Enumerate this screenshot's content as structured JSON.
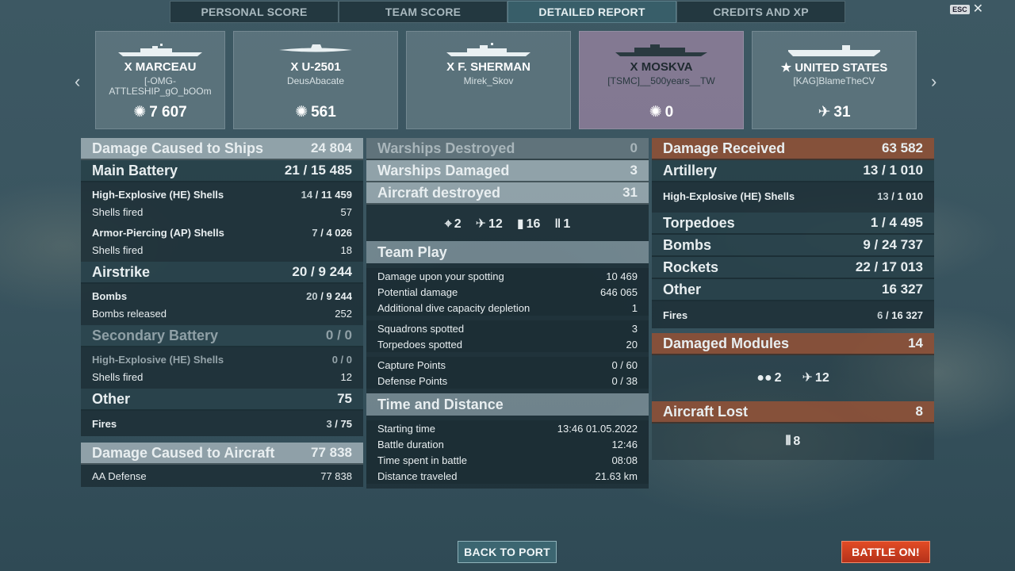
{
  "tabs": [
    "PERSONAL SCORE",
    "TEAM SCORE",
    "DETAILED REPORT",
    "CREDITS AND XP"
  ],
  "active_tab": "DETAILED REPORT",
  "esc_label": "ESC",
  "ships": [
    {
      "name": "X MARCEAU",
      "player": "[-OMG-\nATTLESHIP_gO_bOOm",
      "score": "7 607",
      "score_icon": "damage-burst-icon"
    },
    {
      "name": "X U-2501",
      "player": "DeusAbacate",
      "score": "561",
      "score_icon": "damage-burst-icon"
    },
    {
      "name": "X F. SHERMAN",
      "player": "Mirek_Skov",
      "score": "",
      "score_icon": ""
    },
    {
      "name": "X MOSKVA",
      "player": "[TSMC]__500years__TW",
      "score": "0",
      "score_icon": "damage-burst-icon"
    },
    {
      "name": "★ UNITED STATES",
      "player": "[KAG]BlameTheCV",
      "score": "31",
      "score_icon": "plane-destroyed-icon"
    }
  ],
  "left": {
    "damage_ships": {
      "label": "Damage Caused to Ships",
      "value": "24 804"
    },
    "main_battery": {
      "label": "Main Battery",
      "hits": "21",
      "value": "15 485"
    },
    "he_shells": {
      "label": "High-Explosive (HE) Shells",
      "hits": "14",
      "value": "11 459"
    },
    "he_fired": {
      "label": "Shells fired",
      "value": "57"
    },
    "ap_shells": {
      "label": "Armor-Piercing (AP) Shells",
      "hits": "7",
      "value": "4 026"
    },
    "ap_fired": {
      "label": "Shells fired",
      "value": "18"
    },
    "airstrike": {
      "label": "Airstrike",
      "hits": "20",
      "value": "9 244"
    },
    "bombs": {
      "label": "Bombs",
      "hits": "20",
      "value": "9 244"
    },
    "bombs_released": {
      "label": "Bombs released",
      "value": "252"
    },
    "secondary": {
      "label": "Secondary Battery",
      "value": "0 / 0"
    },
    "sec_he": {
      "label": "High-Explosive (HE) Shells",
      "value": "0 / 0"
    },
    "sec_fired": {
      "label": "Shells fired",
      "value": "12"
    },
    "other": {
      "label": "Other",
      "value": "75"
    },
    "fires": {
      "label": "Fires",
      "hits": "3",
      "value": "75"
    },
    "damage_aircraft": {
      "label": "Damage Caused to Aircraft",
      "value": "77 838"
    },
    "aa_defense": {
      "label": "AA Defense",
      "value": "77 838"
    }
  },
  "middle": {
    "warships_destroyed": {
      "label": "Warships Destroyed",
      "value": "0"
    },
    "warships_damaged": {
      "label": "Warships Damaged",
      "value": "3"
    },
    "aircraft_destroyed": {
      "label": "Aircraft destroyed",
      "value": "31"
    },
    "kill_icons": [
      {
        "icon": "crosshair-icon",
        "value": "2"
      },
      {
        "icon": "plane-shot-icon",
        "value": "12"
      },
      {
        "icon": "bomb-icon",
        "value": "16"
      },
      {
        "icon": "torpedo-salvo-icon",
        "value": "1"
      }
    ],
    "team_play": {
      "title": "Team Play",
      "rows": [
        {
          "label": "Damage upon your spotting",
          "value": "10 469"
        },
        {
          "label": "Potential damage",
          "value": "646 065"
        },
        {
          "label": "Additional dive capacity depletion",
          "value": "1"
        },
        {
          "label": "Squadrons spotted",
          "value": "3"
        },
        {
          "label": "Torpedoes spotted",
          "value": "20"
        },
        {
          "label": "Capture Points",
          "value": "0 / 60"
        },
        {
          "label": "Defense Points",
          "value": "0 / 38"
        }
      ]
    },
    "time_distance": {
      "title": "Time and Distance",
      "rows": [
        {
          "label": "Starting time",
          "value": "13:46  01.05.2022"
        },
        {
          "label": "Battle duration",
          "value": "12:46"
        },
        {
          "label": "Time spent in battle",
          "value": "08:08"
        },
        {
          "label": "Distance traveled",
          "value": "21.63 km"
        }
      ]
    }
  },
  "right": {
    "damage_received": {
      "label": "Damage Received",
      "value": "63 582"
    },
    "artillery": {
      "label": "Artillery",
      "hits": "13",
      "value": "1 010"
    },
    "he_shells": {
      "label": "High-Explosive (HE) Shells",
      "hits": "13",
      "value": "1 010"
    },
    "torpedoes": {
      "label": "Torpedoes",
      "hits": "1",
      "value": "4 495"
    },
    "bombs": {
      "label": "Bombs",
      "hits": "9",
      "value": "24 737"
    },
    "rockets": {
      "label": "Rockets",
      "hits": "22",
      "value": "17 013"
    },
    "other": {
      "label": "Other",
      "value": "16 327"
    },
    "fires": {
      "label": "Fires",
      "hits": "6",
      "value": "16 327"
    },
    "damaged_modules": {
      "label": "Damaged Modules",
      "value": "14"
    },
    "module_icons": [
      {
        "icon": "engine-module-icon",
        "value": "2"
      },
      {
        "icon": "aa-gun-module-icon",
        "value": "12"
      }
    ],
    "aircraft_lost": {
      "label": "Aircraft Lost",
      "value": "8"
    },
    "aircraft_lost_icon": {
      "icon": "squadron-icon",
      "value": "8"
    }
  },
  "buttons": {
    "back_to_port": "BACK TO PORT",
    "battle_on": "BATTLE ON!"
  }
}
